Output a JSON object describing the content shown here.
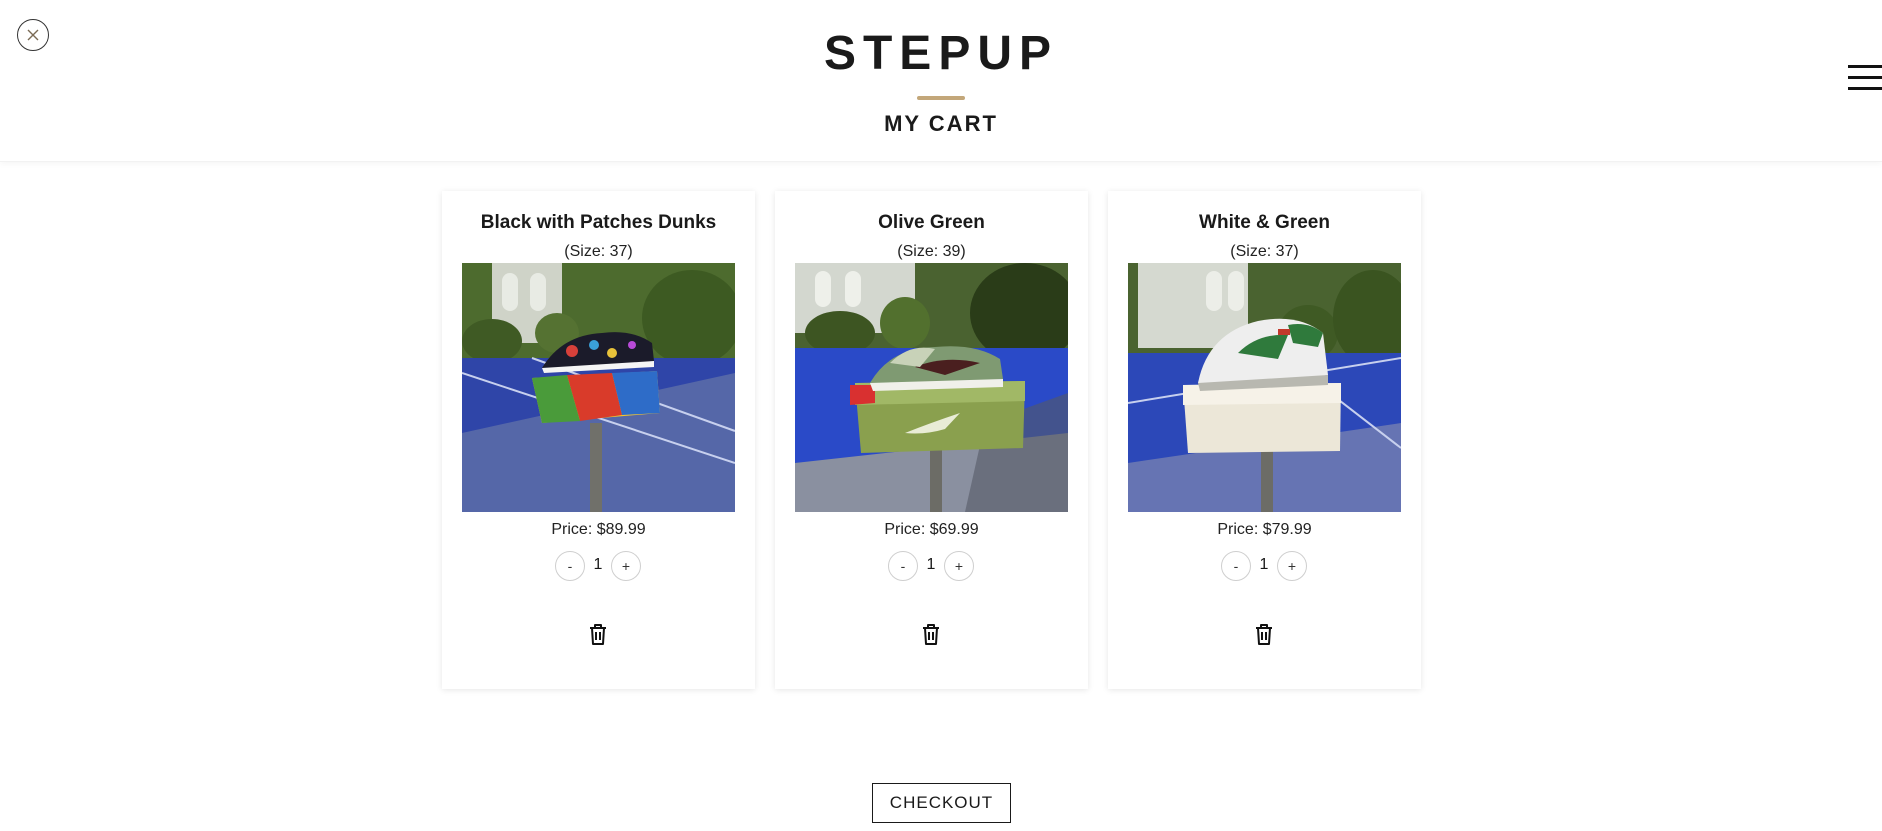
{
  "header": {
    "brand": "STEPUP",
    "title": "MY CART",
    "accent_color": "#c3a77a",
    "close_icon": "close-circle-icon",
    "menu_icon": "hamburger-menu-icon"
  },
  "cart": {
    "items": [
      {
        "name": "Black with Patches Dunks",
        "size": "(Size: 37)",
        "price": "Price: $89.99",
        "quantity": "1",
        "minus": "-",
        "plus": "+",
        "image": "sneaker-black-patches-photo"
      },
      {
        "name": "Olive Green",
        "size": "(Size: 39)",
        "price": "Price: $69.99",
        "quantity": "1",
        "minus": "-",
        "plus": "+",
        "image": "sneaker-olive-green-photo"
      },
      {
        "name": "White & Green",
        "size": "(Size: 37)",
        "price": "Price: $79.99",
        "quantity": "1",
        "minus": "-",
        "plus": "+",
        "image": "sneaker-white-green-photo"
      }
    ]
  },
  "actions": {
    "checkout": "CHECKOUT",
    "delete_icon": "trash-icon"
  }
}
